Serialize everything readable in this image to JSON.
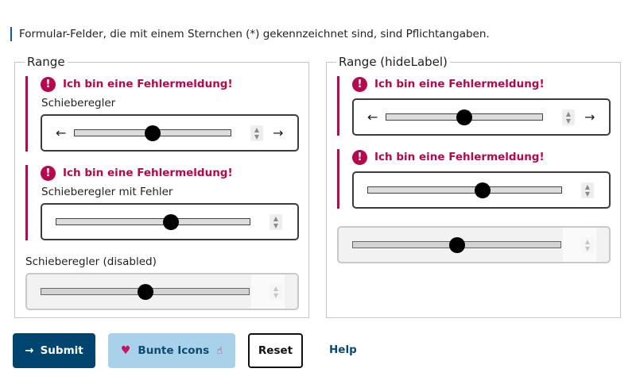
{
  "hint": "Formular-Felder, die mit einem Sternchen (*) gekennzeichnet sind, sind Pflichtangaben.",
  "left_fieldset": {
    "legend": "Range",
    "field1": {
      "error": "Ich bin eine Fehlermeldung!",
      "label": "Schieberegler",
      "value": 0.5,
      "icon_before": "arrow-left-icon",
      "icon_after": "arrow-right-icon"
    },
    "field2": {
      "error": "Ich bin eine Fehlermeldung!",
      "label": "Schieberegler mit Fehler",
      "value": 0.59
    },
    "field3": {
      "label": "Schieberegler (disabled)",
      "value": 0.5,
      "disabled": true
    }
  },
  "right_fieldset": {
    "legend": "Range (hideLabel)",
    "field1": {
      "error": "Ich bin eine Fehlermeldung!",
      "value": 0.5,
      "icon_before": "arrow-left-icon",
      "icon_after": "arrow-right-icon"
    },
    "field2": {
      "error": "Ich bin eine Fehlermeldung!",
      "value": 0.59
    },
    "field3": {
      "value": 0.5,
      "disabled": true
    }
  },
  "glyphs": {
    "error": "!",
    "arrow_left": "←",
    "arrow_right": "→",
    "spin_up": "▲",
    "spin_down": "▼",
    "submit_icon": "→",
    "heart": "♥",
    "hand": "☝"
  },
  "buttons": {
    "submit": "Submit",
    "bunte_icons": "Bunte Icons",
    "reset": "Reset",
    "help": "Help"
  },
  "colors": {
    "error": "#b5084d",
    "primary": "#00456f",
    "secondary_bg": "#a9d2ea",
    "link": "#0c4a74"
  }
}
